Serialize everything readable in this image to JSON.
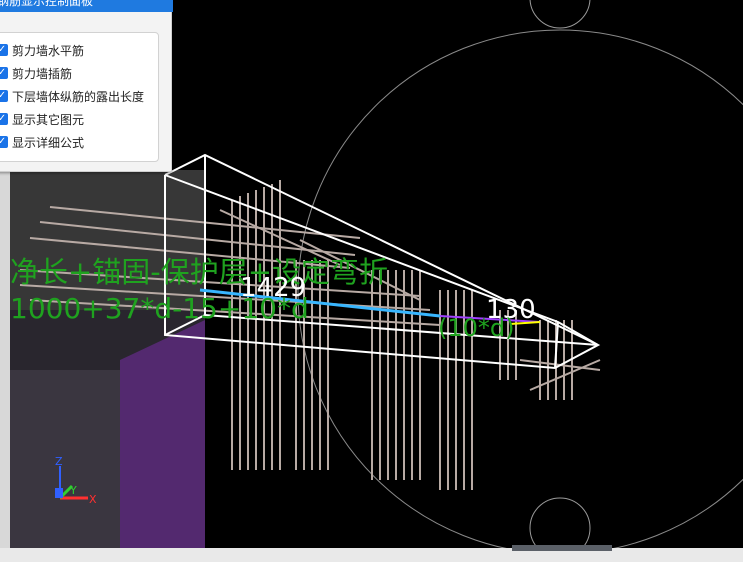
{
  "panel": {
    "title": "钢筋显示控制面板",
    "options": [
      {
        "label": "剪力墙水平筋",
        "checked": true
      },
      {
        "label": "剪力墙插筋",
        "checked": true
      },
      {
        "label": "下层墙体纵筋的露出长度",
        "checked": true
      },
      {
        "label": "显示其它图元",
        "checked": true
      },
      {
        "label": "显示详细公式",
        "checked": true
      }
    ]
  },
  "viewport": {
    "formula_text": "净长+锚固-保护层+设定弯折",
    "formula_values": "1000+37*d-15+10*d",
    "dimension_left": "1429",
    "dimension_right": "130",
    "bend_label": "(10*d)"
  },
  "axis": {
    "x": "X",
    "y": "Y",
    "z": "Z"
  },
  "colors": {
    "background": "#000000",
    "rebar": "#b8aaa4",
    "formula": "#1fa21f",
    "dimension": "#ffffff",
    "circle": "#8a8a8a",
    "panel_header": "#1f7ae0"
  }
}
